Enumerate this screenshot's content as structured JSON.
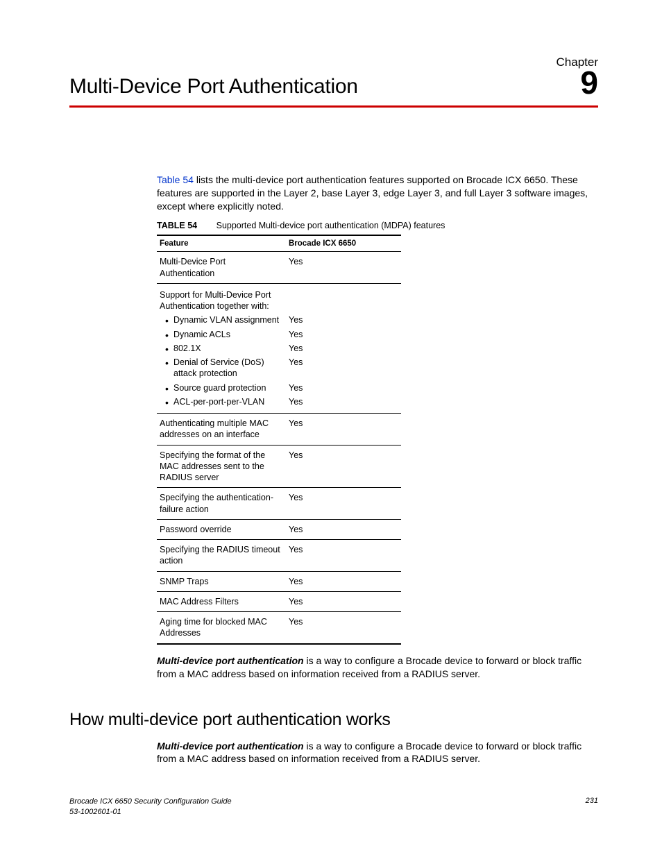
{
  "chapter": {
    "label": "Chapter",
    "number": "9",
    "title": "Multi-Device Port Authentication"
  },
  "intro": {
    "xref": "Table 54",
    "text_after": " lists the multi-device port authentication features supported on Brocade ICX 6650. These features are supported in the Layer 2, base Layer 3, edge Layer 3, and full Layer 3 software images, except where explicitly noted."
  },
  "table": {
    "label": "TABLE 54",
    "caption": "Supported Multi-device port authentication (MDPA) features",
    "headers": {
      "feature": "Feature",
      "device": "Brocade ICX 6650"
    },
    "rows": [
      {
        "feature": "Multi-Device Port Authentication",
        "value": "Yes",
        "type": "row"
      },
      {
        "feature": "Support for Multi-Device Port Authentication together with:",
        "value": "",
        "type": "group-head"
      },
      {
        "feature": "Dynamic VLAN assignment",
        "value": "Yes",
        "type": "bullet"
      },
      {
        "feature": "Dynamic ACLs",
        "value": "Yes",
        "type": "bullet"
      },
      {
        "feature": "802.1X",
        "value": "Yes",
        "type": "bullet"
      },
      {
        "feature": "Denial of Service (DoS) attack protection",
        "value": "Yes",
        "type": "bullet"
      },
      {
        "feature": "Source guard protection",
        "value": "Yes",
        "type": "bullet"
      },
      {
        "feature": "ACL-per-port-per-VLAN",
        "value": "Yes",
        "type": "bullet-last"
      },
      {
        "feature": "Authenticating multiple MAC addresses on an interface",
        "value": "Yes",
        "type": "row"
      },
      {
        "feature": "Specifying the format of the MAC addresses sent to the RADIUS server",
        "value": "Yes",
        "type": "row"
      },
      {
        "feature": "Specifying the authentication-failure action",
        "value": "Yes",
        "type": "row"
      },
      {
        "feature": "Password override",
        "value": "Yes",
        "type": "row"
      },
      {
        "feature": "Specifying the RADIUS timeout action",
        "value": "Yes",
        "type": "row"
      },
      {
        "feature": "SNMP Traps",
        "value": "Yes",
        "type": "row"
      },
      {
        "feature": "MAC Address Filters",
        "value": "Yes",
        "type": "row"
      },
      {
        "feature": "Aging time for blocked MAC Addresses",
        "value": "Yes",
        "type": "row-last"
      }
    ]
  },
  "definition": {
    "term": "Multi-device port authentication",
    "rest": " is a way to configure a Brocade device to forward or block traffic from a MAC address based on information received from a RADIUS server."
  },
  "section": {
    "heading": "How multi-device port authentication works",
    "term": "Multi-device port authentication",
    "rest": " is a way to configure a Brocade device to forward or block traffic from a MAC address based on information received from a RADIUS server."
  },
  "footer": {
    "line1": "Brocade ICX 6650 Security Configuration Guide",
    "line2": "53-1002601-01",
    "page": "231"
  }
}
